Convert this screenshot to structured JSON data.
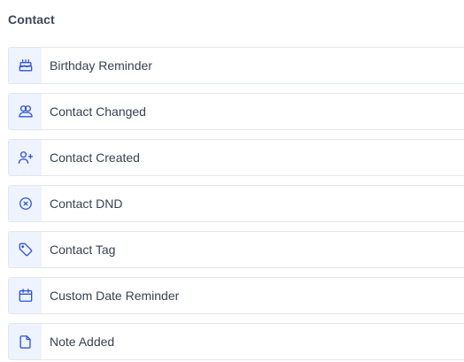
{
  "section": {
    "title": "Contact"
  },
  "triggers": [
    {
      "label": "Birthday Reminder",
      "icon": "cake-icon"
    },
    {
      "label": "Contact Changed",
      "icon": "users-icon"
    },
    {
      "label": "Contact Created",
      "icon": "user-plus-icon"
    },
    {
      "label": "Contact DND",
      "icon": "x-circle-icon"
    },
    {
      "label": "Contact Tag",
      "icon": "tag-icon"
    },
    {
      "label": "Custom Date Reminder",
      "icon": "calendar-icon"
    },
    {
      "label": "Note Added",
      "icon": "file-icon"
    }
  ],
  "colors": {
    "accent": "#2f55d4",
    "icon_background": "#eef3fd",
    "border": "#e3e6eb",
    "text": "#374151",
    "title": "#3f4656"
  }
}
